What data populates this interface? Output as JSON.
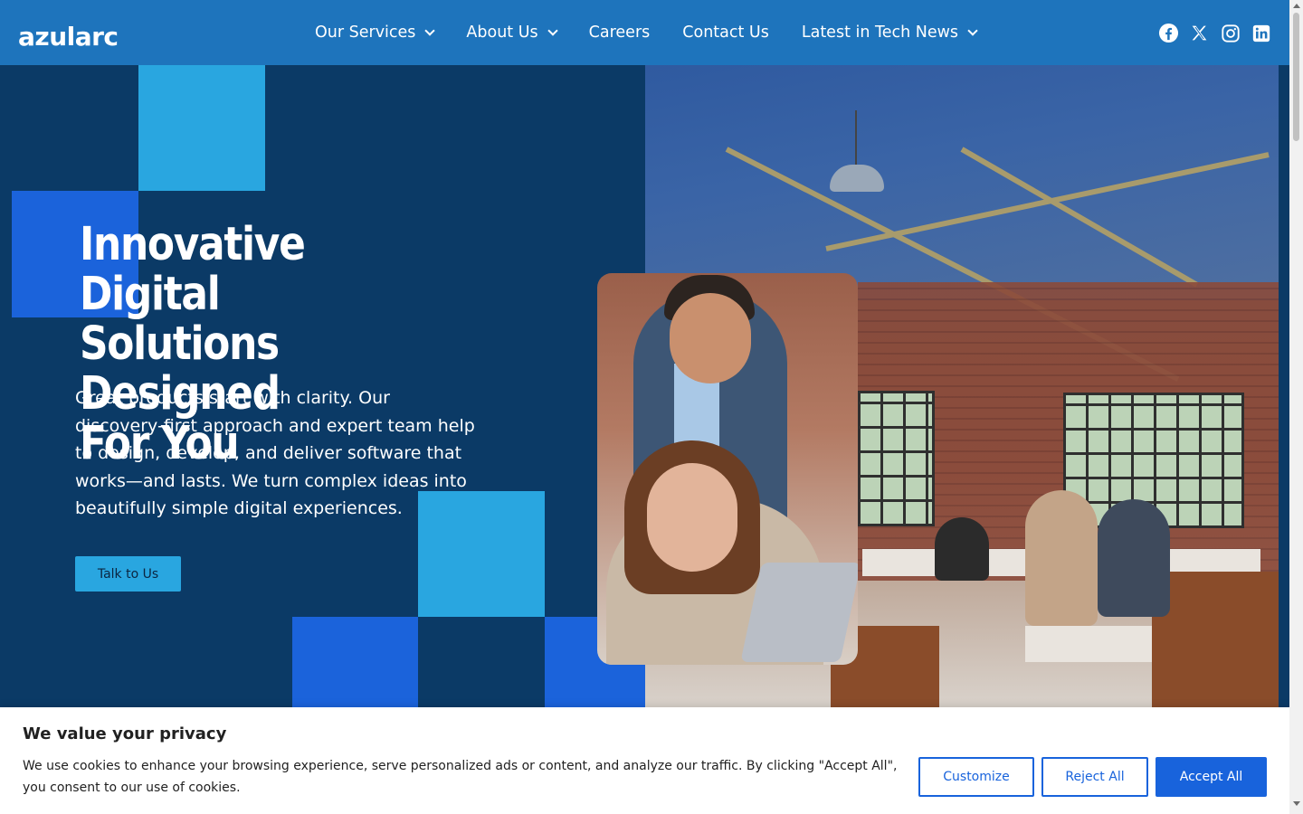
{
  "header": {
    "logo_text": "azularc",
    "nav": [
      {
        "label": "Our Services",
        "has_dropdown": true
      },
      {
        "label": "About Us",
        "has_dropdown": true
      },
      {
        "label": "Careers",
        "has_dropdown": false
      },
      {
        "label": "Contact Us",
        "has_dropdown": false
      },
      {
        "label": "Latest in Tech News",
        "has_dropdown": true
      }
    ],
    "socials": [
      "facebook-icon",
      "x-icon",
      "instagram-icon",
      "linkedin-icon"
    ],
    "background_color": "#1e74bc"
  },
  "hero": {
    "title_lines": [
      "Innovative Digital",
      "Solutions Designed",
      "For You"
    ],
    "description": "Great products start with clarity. Our discovery-first approach and expert team help to design, develop, and deliver software that works—and lasts. We turn complex ideas into beautifully simple digital experiences.",
    "cta_label": "Talk to Us",
    "background_color": "#0b3a66",
    "accent_light": "#29a6e0",
    "accent_blue": "#1b63db"
  },
  "cookie_banner": {
    "title": "We value your privacy",
    "text": "We use cookies to enhance your browsing experience, serve personalized ads or content, and analyze our traffic. By clicking \"Accept All\", you consent to our use of cookies.",
    "buttons": {
      "customize": "Customize",
      "reject": "Reject All",
      "accept": "Accept All"
    },
    "accent_color": "#1863dc"
  }
}
